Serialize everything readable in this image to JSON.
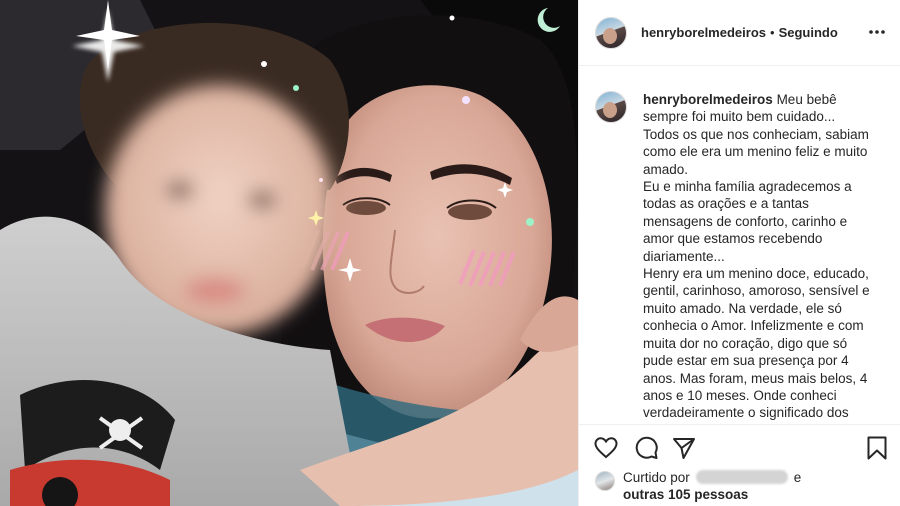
{
  "post": {
    "username": "henryborelmedeiros",
    "separator": "•",
    "follow_status": "Seguindo"
  },
  "caption": {
    "username": "henryborelmedeiros",
    "first_line": "Meu bebê",
    "lines": [
      "sempre foi muito bem cuidado...",
      "Todos os que nos conheciam, sabiam",
      "como ele era um menino feliz e muito",
      "amado.",
      "Eu e minha família agradecemos a",
      "todas as orações e a tantas",
      "mensagens de conforto, carinho e",
      "amor que estamos recebendo",
      "diariamente...",
      "Henry era um menino doce, educado,",
      "gentil, carinhoso, amoroso, sensível e",
      "muito amado. Na verdade, ele só",
      "conhecia o Amor. Infelizmente e com",
      "muita dor no coração, digo que só",
      "pude estar em sua presença por 4",
      "anos. Mas foram, meus mais belos, 4",
      "anos e 10 meses. Onde conheci",
      "verdadeiramente o significado dos"
    ]
  },
  "likes": {
    "prefix": "Curtido por",
    "conjunction": "e",
    "others": "outras 105 pessoas"
  },
  "icons": {
    "more": "more-options-icon",
    "like": "heart-icon",
    "comment": "comment-icon",
    "share": "share-icon",
    "save": "bookmark-icon"
  }
}
